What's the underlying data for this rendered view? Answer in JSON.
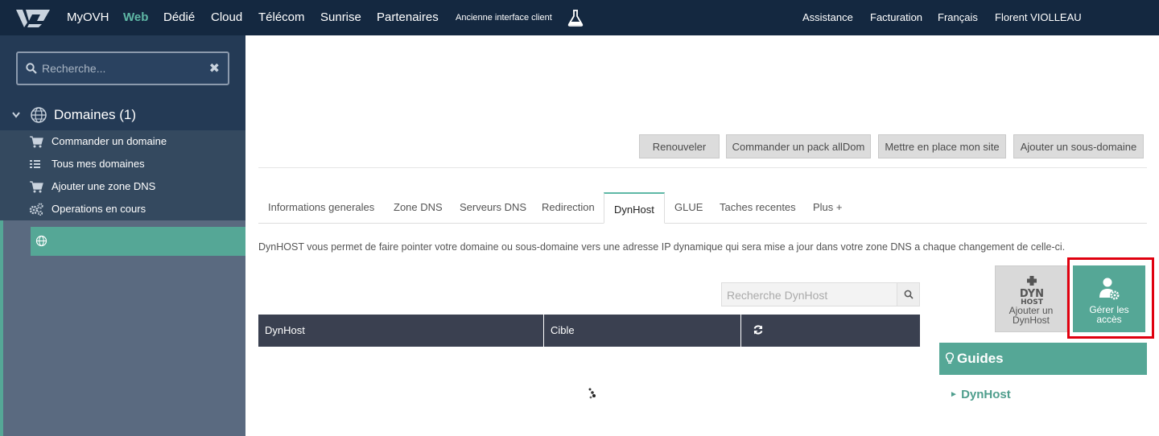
{
  "topbar": {
    "nav": [
      "MyOVH",
      "Web",
      "Dédié",
      "Cloud",
      "Télécom",
      "Sunrise",
      "Partenaires"
    ],
    "active_nav": "Web",
    "old_interface": "Ancienne interface client",
    "right": {
      "assistance": "Assistance",
      "billing": "Facturation",
      "language": "Français",
      "user": "Florent VIOLLEAU"
    }
  },
  "sidebar": {
    "search_placeholder": "Recherche...",
    "clear_glyph": "✖",
    "domains_label": "Domaines (1)",
    "items": [
      {
        "label": "Commander un domaine",
        "icon": "cart-icon"
      },
      {
        "label": "Tous mes domaines",
        "icon": "list-icon"
      },
      {
        "label": "Ajouter une zone DNS",
        "icon": "cart-icon"
      },
      {
        "label": "Operations en cours",
        "icon": "gears-icon"
      }
    ]
  },
  "actions": {
    "renew": "Renouveler",
    "alldom": "Commander un pack allDom",
    "site": "Mettre en place mon site",
    "subdomain": "Ajouter un sous-domaine"
  },
  "tabs": [
    "Informations generales",
    "Zone DNS",
    "Serveurs DNS",
    "Redirection",
    "DynHost",
    "GLUE",
    "Taches recentes",
    "Plus +"
  ],
  "active_tab": "DynHost",
  "description": "DynHOST vous permet de faire pointer votre domaine ou sous-domaine vers une adresse IP dynamique qui sera mise a jour dans votre zone DNS a chaque changement de celle-ci.",
  "dynhost_search_placeholder": "Recherche DynHost",
  "table": {
    "columns": [
      "DynHost",
      "Cible"
    ]
  },
  "tiles": {
    "add_icon_text_1": "DYN",
    "add_icon_text_2": "HOST",
    "add_line1": "Ajouter un",
    "add_line2": "DynHost",
    "access_line1": "Gérer les",
    "access_line2": "accès"
  },
  "guides": {
    "title": "Guides",
    "links": [
      "DynHost"
    ]
  },
  "colors": {
    "topbar": "#142840",
    "accent": "#55a796",
    "sidebar_dark": "#243a55",
    "sidebar_mid": "#34495f",
    "sidebar_light": "#5a6a80",
    "table_header": "#3a4050",
    "highlight": "#e0000f"
  }
}
